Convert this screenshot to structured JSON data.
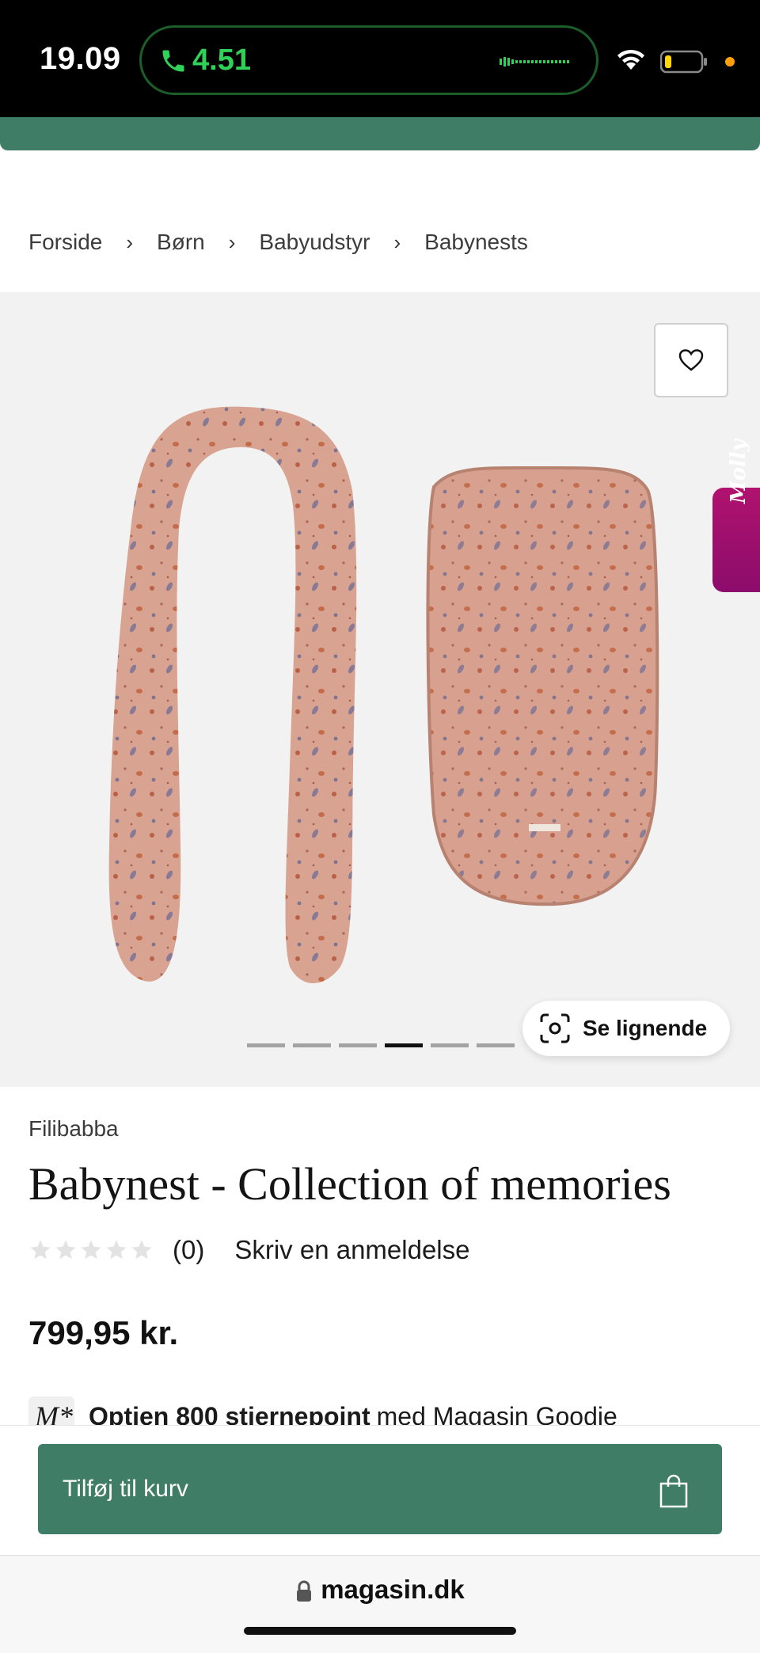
{
  "status_bar": {
    "time": "19.09",
    "call_duration": "4.51"
  },
  "breadcrumb": {
    "items": [
      "Forside",
      "Børn",
      "Babyudstyr",
      "Babynests"
    ],
    "separator": "›"
  },
  "gallery": {
    "image_count": 6,
    "active_index": 3,
    "similar_button_label": "Se lignende",
    "chat_tab_label": "Molly"
  },
  "product": {
    "brand": "Filibabba",
    "title": "Babynest - Collection of memories",
    "rating": {
      "stars": 0,
      "max": 5,
      "review_count": "(0)"
    },
    "write_review": "Skriv en anmeldelse",
    "price": "799,95 kr.",
    "goodie_badge": "M*",
    "points_bold": "Optjen 800 stjernepoint",
    "points_text": "med Magasin Goodie"
  },
  "cart": {
    "add_label": "Tilføj til kurv"
  },
  "browser": {
    "url": "magasin.dk"
  },
  "colors": {
    "accent_green": "#3f7d66",
    "molly_pink": "#b0126e",
    "product_pink": "#d8a08e"
  }
}
